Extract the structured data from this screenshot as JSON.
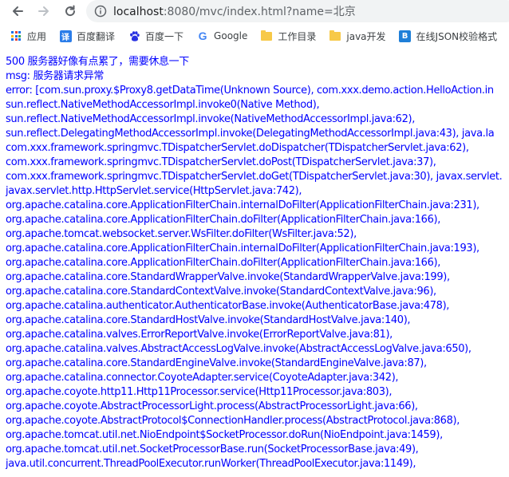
{
  "toolbar": {
    "url_host": "localhost",
    "url_path": ":8080/mvc/index.html?name=北京"
  },
  "bookmarks": [
    {
      "label": "应用",
      "icon": "apps-grid-icon"
    },
    {
      "label": "百度翻译",
      "icon": "baidu-fanyi-icon"
    },
    {
      "label": "百度一下",
      "icon": "baidu-paw-icon"
    },
    {
      "label": "Google",
      "icon": "google-icon"
    },
    {
      "label": "工作目录",
      "icon": "folder-icon"
    },
    {
      "label": "java开发",
      "icon": "folder-icon"
    },
    {
      "label": "在线JSON校验格式",
      "icon": "json-tool-icon"
    }
  ],
  "page": {
    "lines": [
      "500 服务器好像有点累了，需要休息一下",
      "msg: 服务器请求异常",
      "error: [com.sun.proxy.$Proxy8.getDataTime(Unknown Source), com.xxx.demo.action.HelloAction.in",
      "sun.reflect.NativeMethodAccessorImpl.invoke0(Native Method),",
      "sun.reflect.NativeMethodAccessorImpl.invoke(NativeMethodAccessorImpl.java:62),",
      "sun.reflect.DelegatingMethodAccessorImpl.invoke(DelegatingMethodAccessorImpl.java:43), java.la",
      "com.xxx.framework.springmvc.TDispatcherServlet.doDispatcher(TDispatcherServlet.java:62),",
      "com.xxx.framework.springmvc.TDispatcherServlet.doPost(TDispatcherServlet.java:37),",
      "com.xxx.framework.springmvc.TDispatcherServlet.doGet(TDispatcherServlet.java:30), javax.servlet.",
      "javax.servlet.http.HttpServlet.service(HttpServlet.java:742),",
      "org.apache.catalina.core.ApplicationFilterChain.internalDoFilter(ApplicationFilterChain.java:231),",
      "org.apache.catalina.core.ApplicationFilterChain.doFilter(ApplicationFilterChain.java:166),",
      "org.apache.tomcat.websocket.server.WsFilter.doFilter(WsFilter.java:52),",
      "org.apache.catalina.core.ApplicationFilterChain.internalDoFilter(ApplicationFilterChain.java:193),",
      "org.apache.catalina.core.ApplicationFilterChain.doFilter(ApplicationFilterChain.java:166),",
      "org.apache.catalina.core.StandardWrapperValve.invoke(StandardWrapperValve.java:199),",
      "org.apache.catalina.core.StandardContextValve.invoke(StandardContextValve.java:96),",
      "org.apache.catalina.authenticator.AuthenticatorBase.invoke(AuthenticatorBase.java:478),",
      "org.apache.catalina.core.StandardHostValve.invoke(StandardHostValve.java:140),",
      "org.apache.catalina.valves.ErrorReportValve.invoke(ErrorReportValve.java:81),",
      "org.apache.catalina.valves.AbstractAccessLogValve.invoke(AbstractAccessLogValve.java:650),",
      "org.apache.catalina.core.StandardEngineValve.invoke(StandardEngineValve.java:87),",
      "org.apache.catalina.connector.CoyoteAdapter.service(CoyoteAdapter.java:342),",
      "org.apache.coyote.http11.Http11Processor.service(Http11Processor.java:803),",
      "org.apache.coyote.AbstractProcessorLight.process(AbstractProcessorLight.java:66),",
      "org.apache.coyote.AbstractProtocol$ConnectionHandler.process(AbstractProtocol.java:868),",
      "org.apache.tomcat.util.net.NioEndpoint$SocketProcessor.doRun(NioEndpoint.java:1459),",
      "org.apache.tomcat.util.net.SocketProcessorBase.run(SocketProcessorBase.java:49),",
      "java.util.concurrent.ThreadPoolExecutor.runWorker(ThreadPoolExecutor.java:1149),"
    ]
  },
  "colors": {
    "text": "#0000ff",
    "omnibox": "#f1f3f4",
    "folder": "#f7c948"
  }
}
